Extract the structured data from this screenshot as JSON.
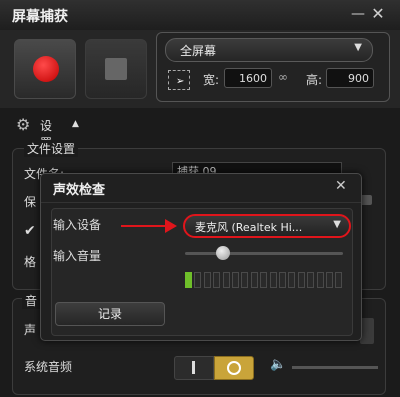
{
  "window": {
    "title": "屏幕捕获",
    "minimize_icon": "minimize-icon",
    "close_icon": "close-icon"
  },
  "capture": {
    "region_mode": "全屏幕",
    "width_label": "宽:",
    "width_value": "1600",
    "height_label": "高:",
    "height_value": "900"
  },
  "settings": {
    "label": "设置"
  },
  "file_settings": {
    "title": "文件设置",
    "filename_label": "文件名:",
    "filename_value": "捕获 09",
    "save_label": "保",
    "format_label": "格"
  },
  "audio": {
    "title": "音",
    "sound_label": "声",
    "system_audio_label": "系统音频"
  },
  "dialog": {
    "title": "声效检查",
    "input_device_label": "输入设备",
    "input_device_value": "麦克风 (Realtek Hi...",
    "input_volume_label": "输入音量",
    "input_volume_level": 0.24,
    "meter_segments_total": 17,
    "meter_segments_active": 1,
    "record_button": "记录"
  },
  "colors": {
    "record_red": "#e01b1b",
    "annotation_red": "#e0151b",
    "meter_green": "#6fbf2a",
    "toggle_gold": "#c9a43a"
  }
}
